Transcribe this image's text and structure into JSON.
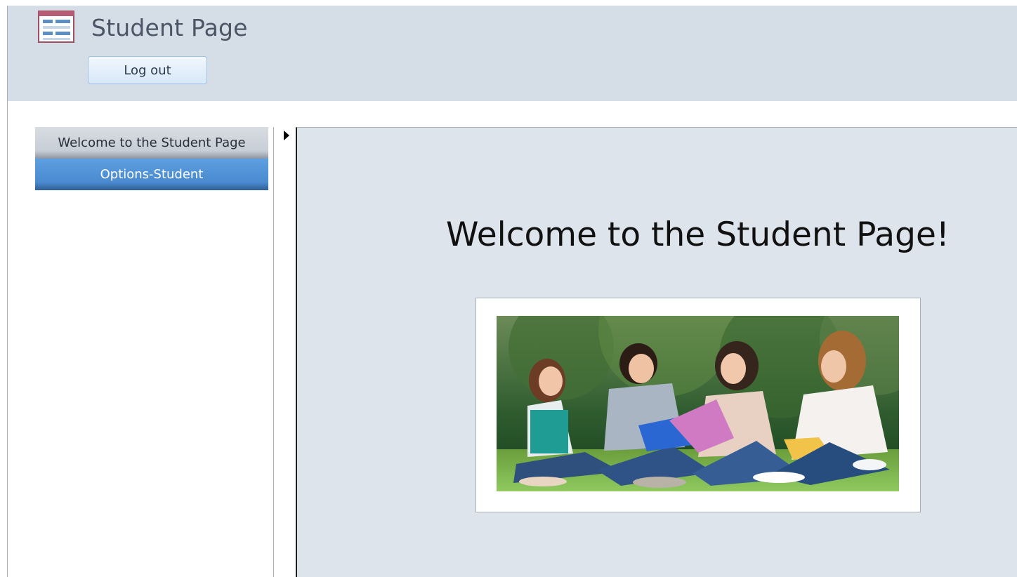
{
  "header": {
    "title": "Student Page",
    "form_icon": "form-icon",
    "logout_label": "Log out"
  },
  "navigation": {
    "items": [
      {
        "label": "Welcome to the Student Page",
        "selected": true
      },
      {
        "label": "Options-Student",
        "selected": false
      }
    ]
  },
  "content": {
    "heading": "Welcome to the Student Page!",
    "record_selector_icon": "triangle-right-icon",
    "photo_description_icon": "students-photo"
  },
  "colors": {
    "header_background": "#d5dde6",
    "content_background": "#dde4ec",
    "options_tab": "#4a8ad0",
    "welcome_tab": "#c8ced6",
    "logout_button": "#d7e8f8"
  }
}
